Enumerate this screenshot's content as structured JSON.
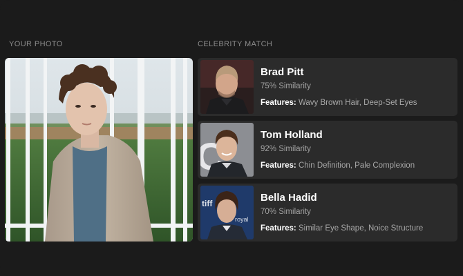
{
  "your_photo": {
    "label": "YOUR PHOTO"
  },
  "celebrity": {
    "label": "CELEBRITY MATCH",
    "matches": [
      {
        "name": "Brad Pitt",
        "similarity": "75% Similarity",
        "features_label": "Features:",
        "features": "Wavy Brown Hair, Deep-Set Eyes"
      },
      {
        "name": "Tom Holland",
        "similarity": "92% Similarity",
        "features_label": "Features:",
        "features": "Chin Definition, Pale Complexion"
      },
      {
        "name": "Bella Hadid",
        "similarity": "70% Similarity",
        "features_label": "Features:",
        "features": "Similar Eye Shape, Noice Structure"
      }
    ]
  },
  "thumb_texts": {
    "holland_bg": "C",
    "hadid_bg_1": "tiff",
    "hadid_bg_2": "royal"
  },
  "colors": {
    "background": "#1b1b1b",
    "card": "#2b2b2b",
    "muted_text": "#8c8c8c"
  }
}
